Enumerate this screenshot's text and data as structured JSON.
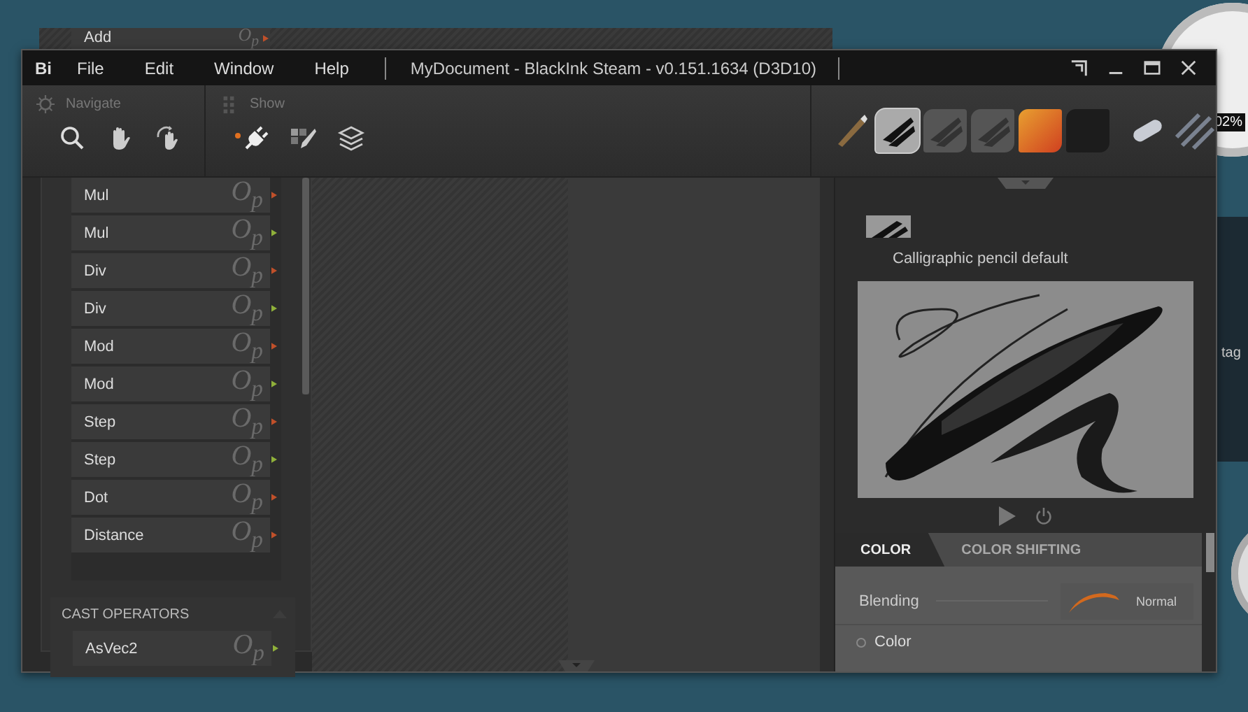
{
  "desktop": {
    "gauge_reading": "02%",
    "widget_label": "tag"
  },
  "background_window": {
    "row": {
      "name": "Add",
      "op_label": "O$_{p}$",
      "color": "#c0502a"
    }
  },
  "window": {
    "logo": "Bi",
    "menu": [
      "File",
      "Edit",
      "Window",
      "Help"
    ],
    "title": "MyDocument - BlackInk Steam - v0.151.1634 (D3D10)"
  },
  "toolbar": {
    "groups": [
      {
        "label": "Navigate",
        "kind": "gear",
        "tools": [
          {
            "kind": "search",
            "selected": false
          },
          {
            "kind": "hand",
            "selected": false
          },
          {
            "kind": "rotate",
            "selected": false
          }
        ]
      },
      {
        "label": "Show",
        "kind": "grip",
        "tools": [
          {
            "kind": "node",
            "selected": true
          },
          {
            "kind": "brush",
            "selected": false
          },
          {
            "kind": "layers",
            "selected": false
          }
        ]
      }
    ]
  },
  "brushes": [
    {
      "kind": "pencil",
      "selected": false
    },
    {
      "kind": "calligraphic",
      "selected": true
    },
    {
      "kind": "calligraphic",
      "selected": false
    },
    {
      "kind": "calligraphic",
      "selected": false
    },
    {
      "kind": "paint",
      "selected": false
    },
    {
      "kind": "empty",
      "selected": false
    },
    {
      "kind": "eraser",
      "selected": false
    },
    {
      "kind": "hatching",
      "selected": false
    }
  ],
  "operators": [
    {
      "name": "Mul",
      "op_label": "O$_{p}$",
      "color": "#c0502a"
    },
    {
      "name": "Mul",
      "op_label": "O$_{p}$",
      "color": "#8fb03a"
    },
    {
      "name": "Div",
      "op_label": "O$_{p}$",
      "color": "#c0502a"
    },
    {
      "name": "Div",
      "op_label": "O$_{p}$",
      "color": "#8fb03a"
    },
    {
      "name": "Mod",
      "op_label": "O$_{p}$",
      "color": "#c0502a"
    },
    {
      "name": "Mod",
      "op_label": "O$_{p}$",
      "color": "#8fb03a"
    },
    {
      "name": "Step",
      "op_label": "O$_{p}$",
      "color": "#c0502a"
    },
    {
      "name": "Step",
      "op_label": "O$_{p}$",
      "color": "#8fb03a"
    },
    {
      "name": "Dot",
      "op_label": "O$_{p}$",
      "color": "#c0502a"
    },
    {
      "name": "Distance",
      "op_label": "O$_{p}$",
      "color": "#c0502a"
    }
  ],
  "cast_section": {
    "title": "CAST OPERATORS",
    "items": [
      {
        "name": "AsVec2",
        "op_label": "O$_{p}$",
        "color": "#8fb03a"
      }
    ]
  },
  "brush_panel": {
    "name": "Calligraphic pencil default",
    "tabs": [
      {
        "label": "COLOR",
        "selected": true
      },
      {
        "label": "COLOR SHIFTING",
        "selected": false
      }
    ],
    "blending": {
      "label": "Blending",
      "value": "Normal"
    },
    "color_option": {
      "label": "Color",
      "checked": false
    }
  }
}
